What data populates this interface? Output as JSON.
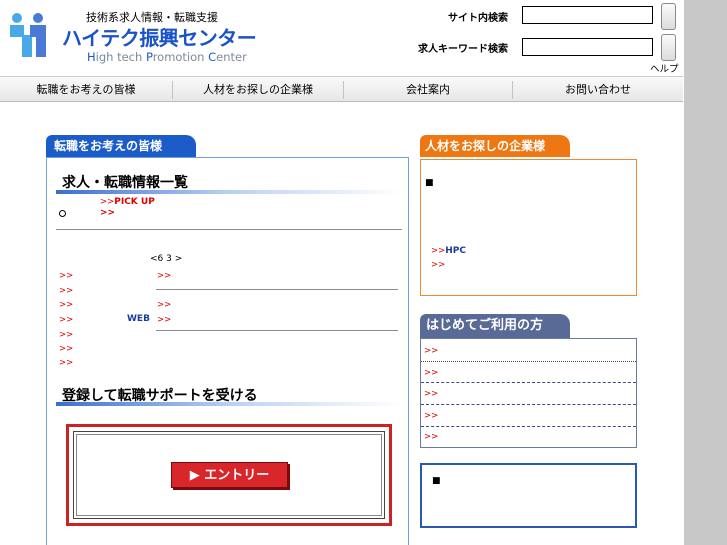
{
  "header": {
    "logo_sub": "技術系求人情報・転職支援",
    "logo_main": "ハイテク振興センター",
    "logo_en": {
      "part1": "H",
      "part2": "igh tech ",
      "part3": "P",
      "part4": "romotion ",
      "part5": "C",
      "part6": "enter"
    },
    "site_search_label": "サイト内検索",
    "keyword_search_label": "求人キーワード検索",
    "site_search_value": "",
    "keyword_search_value": "",
    "help_label": "ヘルプ"
  },
  "nav": {
    "items": [
      "転職をお考えの皆様",
      "人材をお探しの企業様",
      "会社案内",
      "お問い合わせ"
    ]
  },
  "left_panel": {
    "tab_label": "転職をお考えの皆様",
    "section1_title": "求人・転職情報一覧",
    "pickup_prefix": ">>",
    "pickup_label": "PICK UP",
    "radio_symbol": "○",
    "arrow_row": ">>",
    "count_text": "<6 3  >",
    "links": [
      ">>",
      ">>",
      ">>",
      ">>",
      ">>",
      ">>",
      ">>"
    ],
    "mid_links": [
      ">>",
      ">>",
      ">>"
    ],
    "web_label": "WEB",
    "section2_title": "登録して転職サポートを受ける",
    "entry_button": "▶ エントリー"
  },
  "right_column": {
    "orange_tab": "人材をお探しの企業様",
    "orange_bullet": "■",
    "hpc_prefix": ">>",
    "hpc_label": "HPC",
    "orange_link": ">>",
    "slate_tab": "はじめてご利用の方",
    "slate_links": [
      ">>",
      ">>",
      ">>",
      ">>",
      ">>"
    ],
    "blue_bullet": "■"
  },
  "colors": {
    "brand_blue": "#1a52c7",
    "tab_blue": "#1c5cc8",
    "tab_orange": "#ee7711",
    "tab_slate": "#5a6a97",
    "link_red": "#dd0000",
    "entry_red": "#d8262b"
  }
}
